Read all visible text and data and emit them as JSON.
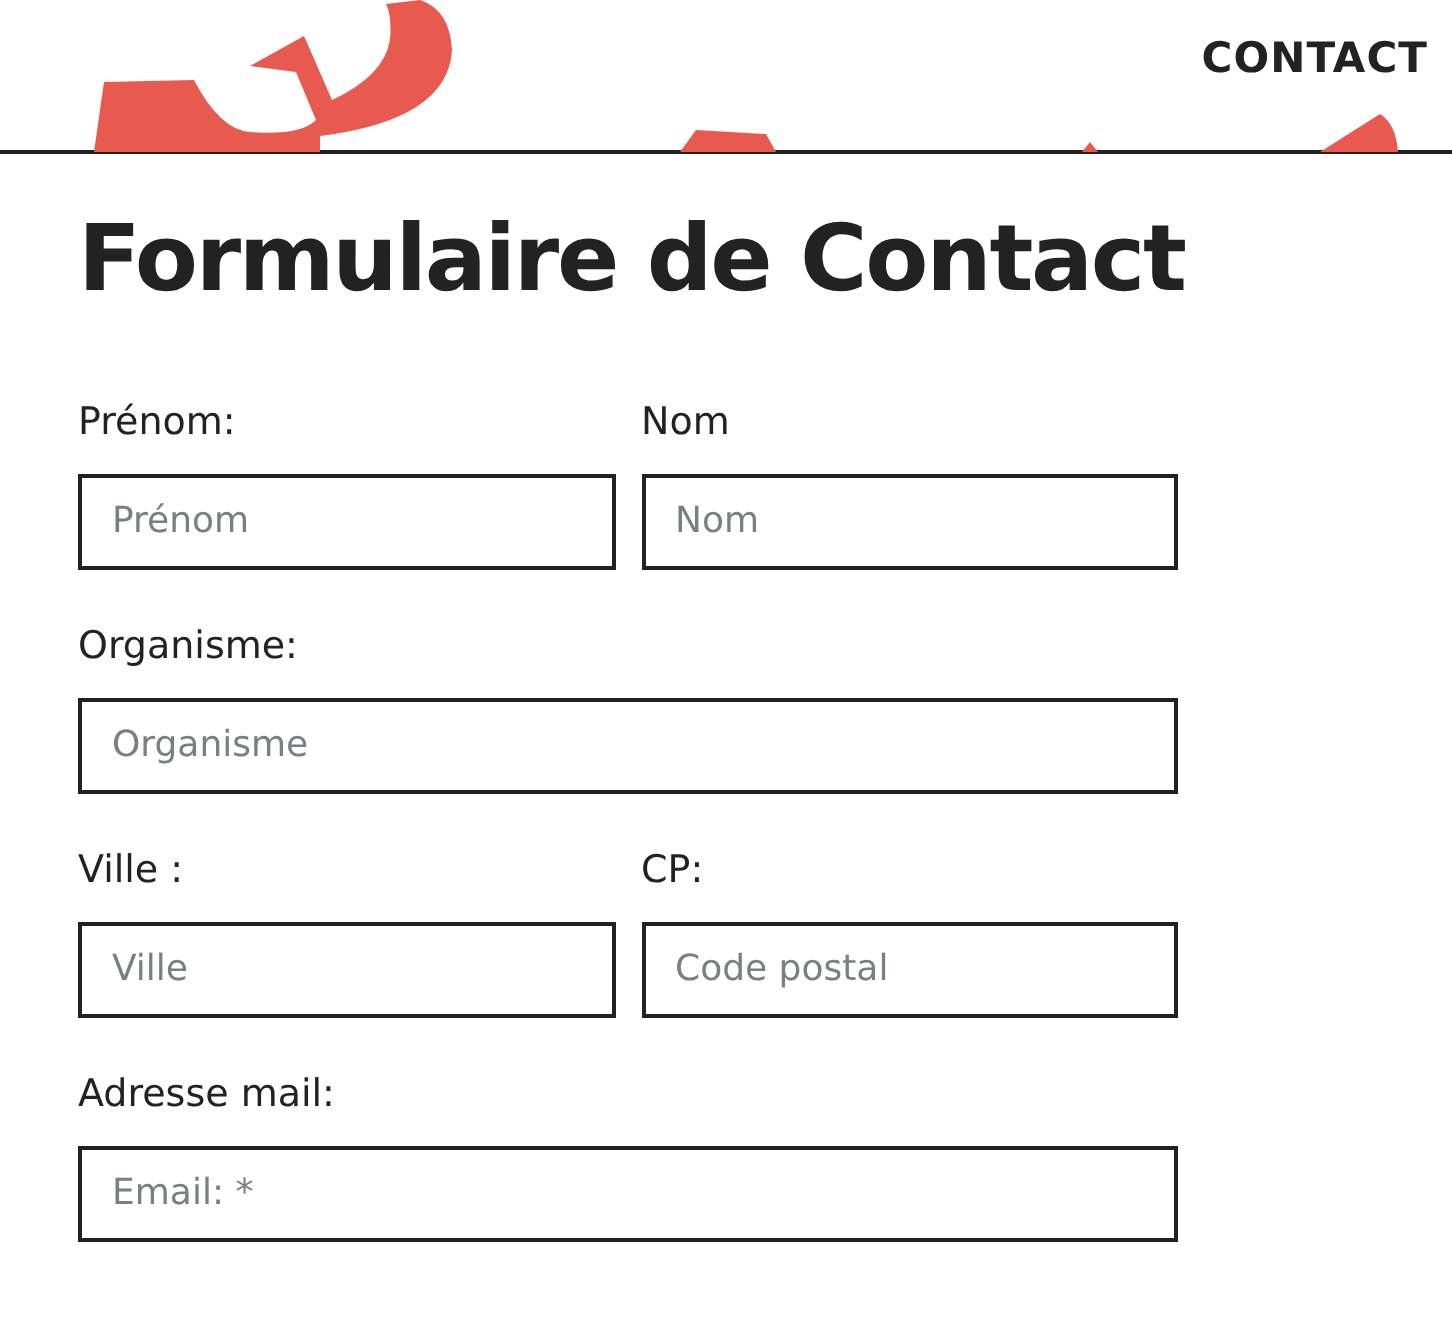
{
  "header": {
    "nav_link": "CONTACT"
  },
  "title": "Formulaire de Contact",
  "form_rows": [
    [
      {
        "label": "Prénom:",
        "placeholder": "Prénom"
      },
      {
        "label": "Nom",
        "placeholder": "Nom"
      }
    ],
    [
      {
        "label": "Organisme:",
        "placeholder": "Organisme"
      }
    ],
    [
      {
        "label": "Ville :",
        "placeholder": "Ville"
      },
      {
        "label": "CP:",
        "placeholder": "Code postal"
      }
    ],
    [
      {
        "label": "Adresse mail:",
        "placeholder": "Email: *"
      }
    ]
  ]
}
